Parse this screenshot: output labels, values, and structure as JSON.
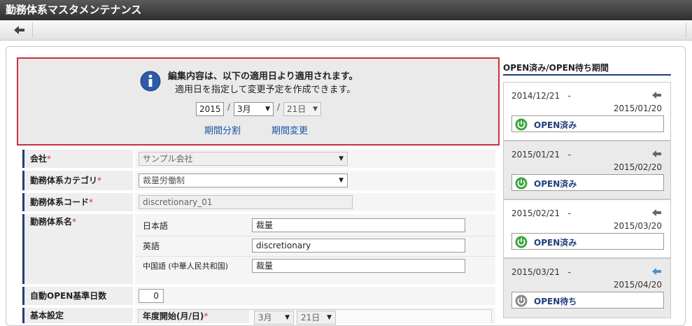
{
  "window": {
    "title": "勤務体系マスタメンテナンス"
  },
  "notice": {
    "line1": "編集内容は、以下の適用日より適用されます。",
    "line2": "適用日を指定して変更予定を作成できます。",
    "year": "2015",
    "month": "3月",
    "day": "21日",
    "slash": "/",
    "split_link": "期間分割",
    "change_link": "期間変更"
  },
  "form": {
    "company_label": "会社",
    "company_value": "サンプル会社",
    "category_label": "勤務体系カテゴリ",
    "category_value": "裁量労働制",
    "code_label": "勤務体系コード",
    "code_value": "discretionary_01",
    "name_label": "勤務体系名",
    "name_ja_label": "日本語",
    "name_ja_value": "裁量",
    "name_en_label": "英語",
    "name_en_value": "discretionary",
    "name_zh_label": "中国語 (中華人民共和国)",
    "name_zh_value": "裁量",
    "auto_open_label": "自動OPEN基準日数",
    "auto_open_value": "0",
    "basic_label": "基本設定",
    "year_start_label": "年度開始(月/日)",
    "year_start_month": "3月",
    "year_start_day": "21日",
    "required_mark": "*"
  },
  "periods": {
    "title": "OPEN済み/OPEN待ち期間",
    "dash": "-",
    "items": [
      {
        "start": "2014/12/21",
        "end": "2015/01/20",
        "status": "OPEN済み"
      },
      {
        "start": "2015/01/21",
        "end": "2015/02/20",
        "status": "OPEN済み"
      },
      {
        "start": "2015/02/21",
        "end": "2015/03/20",
        "status": "OPEN済み"
      },
      {
        "start": "2015/03/21",
        "end": "2015/04/20",
        "status": "OPEN待ち"
      }
    ]
  },
  "colors": {
    "accent_red": "#c8323b",
    "nav_blue": "#1f3f7a",
    "link_blue": "#1f55a5",
    "open_green": "#3aa63a",
    "waiting_gray": "#8a8a8a"
  }
}
